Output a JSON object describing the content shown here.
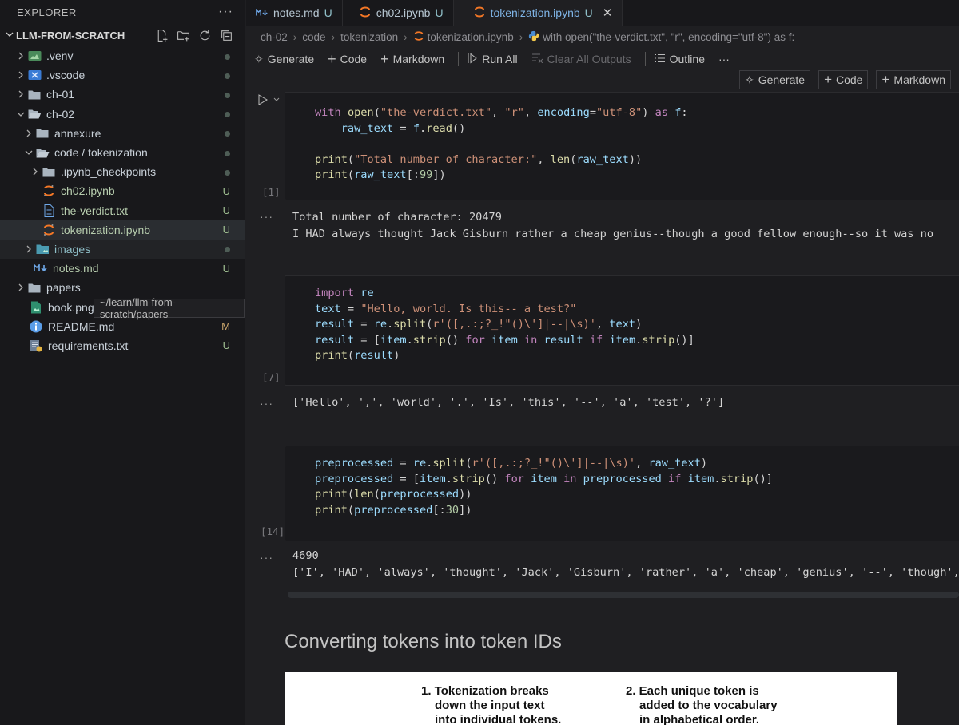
{
  "explorer": {
    "title": "EXPLORER",
    "more": "···",
    "root": "LLM-FROM-SCRATCH",
    "items": [
      {
        "label": ".venv",
        "badge": "dot"
      },
      {
        "label": ".vscode",
        "badge": "dot"
      },
      {
        "label": "ch-01",
        "badge": "dot"
      },
      {
        "label": "ch-02",
        "badge": "dot"
      },
      {
        "label": "annexure",
        "badge": "dot"
      },
      {
        "label": "code / tokenization",
        "badge": "dot"
      },
      {
        "label": ".ipynb_checkpoints",
        "badge": "dot"
      },
      {
        "label": "ch02.ipynb",
        "badge": "U"
      },
      {
        "label": "the-verdict.txt",
        "badge": "U"
      },
      {
        "label": "tokenization.ipynb",
        "badge": "U"
      },
      {
        "label": "images",
        "badge": "dot"
      },
      {
        "label": "notes.md",
        "badge": "U"
      },
      {
        "label": "papers",
        "badge": ""
      },
      {
        "label": "book.png",
        "badge": ""
      },
      {
        "label": "README.md",
        "badge": "M"
      },
      {
        "label": "requirements.txt",
        "badge": "U"
      }
    ],
    "tooltip": "~/learn/llm-from-scratch/papers"
  },
  "tabs": [
    {
      "label": "notes.md",
      "status": "U"
    },
    {
      "label": "ch02.ipynb",
      "status": "U"
    },
    {
      "label": "tokenization.ipynb",
      "status": "U"
    }
  ],
  "breadcrumb": [
    "ch-02",
    "code",
    "tokenization",
    "tokenization.ipynb",
    "with open(\"the-verdict.txt\", \"r\", encoding=\"utf-8\") as f:"
  ],
  "toolbar": {
    "generate": "Generate",
    "code": "Code",
    "markdown": "Markdown",
    "run_all": "Run All",
    "clear": "Clear All Outputs",
    "outline": "Outline",
    "more": "···"
  },
  "cellbar": {
    "generate": "Generate",
    "code": "Code",
    "markdown": "Markdown"
  },
  "cells": [
    {
      "exec": "[1]",
      "output_lines": [
        "Total number of character: 20479",
        "I HAD always thought Jack Gisburn rather a cheap genius--though a good fellow enough--so it was no"
      ]
    },
    {
      "exec": "[7]",
      "output_lines": [
        "['Hello', ',', 'world', '.', 'Is', 'this', '--', 'a', 'test', '?']"
      ]
    },
    {
      "exec": "[14]",
      "output_lines": [
        "4690",
        "['I', 'HAD', 'always', 'thought', 'Jack', 'Gisburn', 'rather', 'a', 'cheap', 'genius', '--', 'though', 'a"
      ]
    }
  ],
  "output_dots": "···",
  "markdown_heading": "Converting tokens into token IDs",
  "figure": {
    "note1": [
      "1. Tokenization breaks",
      "down the input text",
      "into individual tokens."
    ],
    "note2": [
      "2. Each unique token is",
      "added to the vocabulary",
      "in alphabetical order."
    ]
  }
}
